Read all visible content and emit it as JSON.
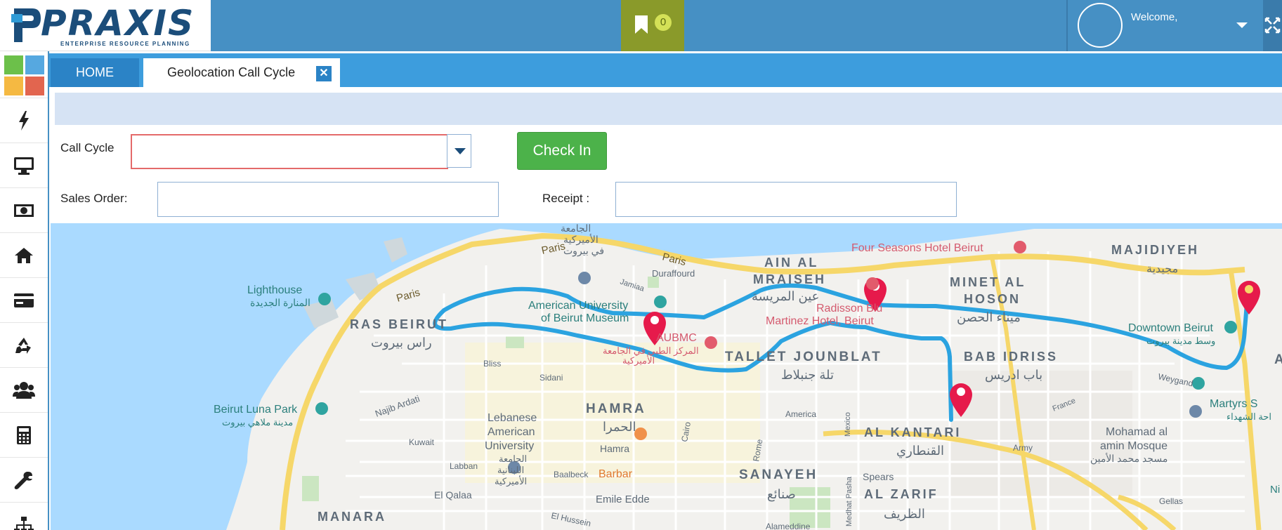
{
  "app": {
    "logo_text": "PRAXIS",
    "logo_subtitle": "ENTERPRISE RESOURCE PLANNING",
    "registered_mark": "®"
  },
  "header": {
    "bookmark_count": "0",
    "welcome": "Welcome,"
  },
  "tabs": [
    {
      "label": "HOME"
    },
    {
      "label": "Geolocation Call Cycle"
    }
  ],
  "tab_close_glyph": "✕",
  "form": {
    "call_cycle_label": "Call Cycle",
    "call_cycle_value": "",
    "check_in_label": "Check In",
    "sales_order_label": "Sales Order:",
    "sales_order_value": "",
    "receipt_label": "Receipt :",
    "receipt_value": ""
  },
  "sidebar": {
    "icons": [
      "apps-grid-icon",
      "bolt-icon",
      "monitor-icon",
      "money-icon",
      "home-icon",
      "credit-card-icon",
      "recycle-icon",
      "users-icon",
      "calculator-icon",
      "wrench-icon",
      "sitemap-icon"
    ]
  },
  "map": {
    "labels": {
      "paris1": "Paris",
      "paris2": "Paris",
      "paris3": "Paris",
      "lighthouse": "Lighthouse",
      "lighthouse_ar": "المنارة الجديدة",
      "ras_beirut": "RAS BEIRUT",
      "ras_beirut_ar": "راس بيروت",
      "auc_ar1": "الجامعة",
      "auc_ar2": "الأميركية",
      "auc_ar3": "في بيروت",
      "aub_museum1": "American University",
      "aub_museum2": "of Beirut Museum",
      "jamiaa": "Jamiaa",
      "duraffourd": "Duraffourd",
      "ain_al": "AIN AL",
      "mraiseh": "MRAISEH",
      "mraiseh_ar": "عين المريسة",
      "four_seasons": "Four Seasons Hotel Beirut",
      "radisson1": "Radisson Blu",
      "radisson2": "Martinez Hotel, Beirut",
      "minet_al": "MINET AL",
      "hoson": "HOSON",
      "hoson_ar": "ميناء الحصن",
      "majidiyeh": "MAJIDIYEH",
      "majidiyeh_ar": "مجيدية",
      "downtown": "Downtown Beirut",
      "downtown_ar": "وسط مدينة بيروت",
      "aubmc": "AUBMC",
      "aubmc_ar1": "المركز الطبي في الجامعة",
      "aubmc_ar2": "الأميركية",
      "tallet": "TALLET JOUNBLAT",
      "tallet_ar": "تلة جنبلاط",
      "bab_idriss": "BAB IDRISS",
      "bab_idriss_ar": "باب ادريس",
      "weygand": "Weygand",
      "martyrs": "Martyrs S",
      "martyrs_ar": "احة الشهداء",
      "hamra": "HAMRA",
      "hamra_ar": "الحمرا",
      "hamra_st": "Hamra",
      "sidani": "Sidani",
      "bliss": "Bliss",
      "najib_ardati": "Najib Ardati",
      "kuwait": "Kuwait",
      "lau1": "Lebanese",
      "lau2": "American",
      "lau3": "University",
      "lau_ar1": "الجامعة",
      "lau_ar2": "اللبنانية",
      "lau_ar3": "الأميركية",
      "luna_park": "Beirut Luna Park",
      "luna_park_ar": "مدينة ملاهي بيروت",
      "labban": "Labban",
      "baalbeck": "Baalbeck",
      "barbar": "Barbar",
      "el_qalaa": "El Qalaa",
      "emile_edde": "Emile Edde",
      "el_hussein": "El Hussein",
      "manara": "MANARA",
      "cairo": "Cairo",
      "rome": "Rome",
      "america": "America",
      "mexico": "Mexico",
      "medhat": "Medhat Pasha",
      "alameddine": "Alameddine",
      "sanayeh": "SANAYEH",
      "sanayeh_ar": "صنائع",
      "spears": "Spears",
      "al_kantari": "AL KANTARI",
      "al_kantari_ar": "القنطاري",
      "al_zarif": "AL ZARIF",
      "al_zarif_ar": "الظريف",
      "army": "Army",
      "france": "France",
      "mohamad1": "Mohamad al",
      "mohamad2": "amin Mosque",
      "mohamad_ar": "مسجد محمد الأمين",
      "gellas": "Gellas",
      "ni": "Ni",
      "a_edge": "A"
    }
  }
}
